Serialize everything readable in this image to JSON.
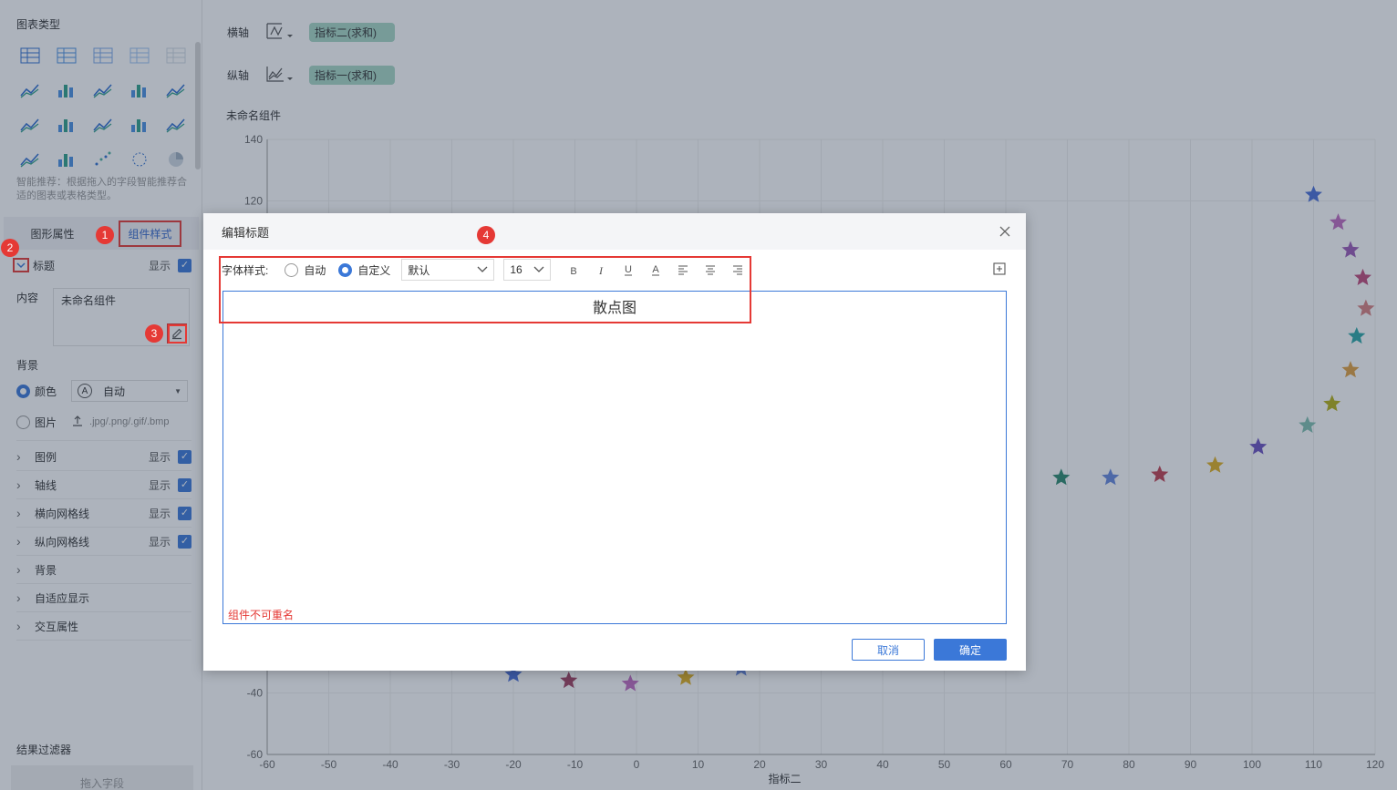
{
  "left_panel": {
    "chart_types_title": "图表类型",
    "chart_types": [
      "table-icon",
      "cross-table-icon",
      "detail-table-icon",
      "kpi-number-icon",
      "text-icon",
      "matrix-icon",
      "heatmap-icon",
      "stacked-bar-icon",
      "bar-icon",
      "grouped-bar-icon",
      "bar-line-icon",
      "step-icon",
      "line-icon",
      "radar-line-icon",
      "radar-icon",
      "area-icon",
      "combo-bar-icon",
      "scatter-icon",
      "bubble-icon",
      "pie-icon"
    ],
    "hint": "智能推荐：根据拖入的字段智能推荐合适的图表或表格类型。",
    "tab_graph": "图形属性",
    "tab_style": "组件样式",
    "title_section": "标题",
    "show": "显示",
    "content_label": "内容",
    "content_value": "未命名组件",
    "background_label": "背景",
    "bg_color": "颜色",
    "bg_auto": "自动",
    "bg_image": "图片",
    "bg_image_formats": ".jpg/.png/.gif/.bmp",
    "sections": [
      "图例",
      "轴线",
      "横向网格线",
      "纵向网格线",
      "背景",
      "自适应显示",
      "交互属性"
    ],
    "filter_title": "结果过滤器",
    "filter_placeholder": "拖入字段"
  },
  "axes": {
    "x_label": "横轴",
    "x_field": "指标二(求和)",
    "y_label": "纵轴",
    "y_field": "指标一(求和)"
  },
  "widget_title": "未命名组件",
  "chart_data": {
    "type": "scatter",
    "xlabel": "指标二",
    "ylabel": "",
    "xlim": [
      -60,
      120
    ],
    "ylim": [
      -60,
      140
    ],
    "x_ticks": [
      -60,
      -50,
      -40,
      -30,
      -20,
      -10,
      0,
      10,
      20,
      30,
      40,
      50,
      60,
      70,
      80,
      90,
      100,
      110,
      120
    ],
    "y_ticks": [
      140,
      120,
      -40,
      -60
    ],
    "marker": "star",
    "points": [
      {
        "x": 110.0,
        "y": 122,
        "color": "#4a6fd8"
      },
      {
        "x": 114.0,
        "y": 113,
        "color": "#c06bc0"
      },
      {
        "x": 116.0,
        "y": 104,
        "color": "#9b59b6"
      },
      {
        "x": 118.0,
        "y": 95,
        "color": "#c0497a"
      },
      {
        "x": 118.5,
        "y": 85,
        "color": "#d98080"
      },
      {
        "x": 117.0,
        "y": 76,
        "color": "#2aa7a7"
      },
      {
        "x": 116.0,
        "y": 65,
        "color": "#e0a040"
      },
      {
        "x": 113.0,
        "y": 54,
        "color": "#b5b015"
      },
      {
        "x": 109.0,
        "y": 47,
        "color": "#80c0b0"
      },
      {
        "x": 101.0,
        "y": 40,
        "color": "#6b52c0"
      },
      {
        "x": 94.0,
        "y": 34,
        "color": "#e0b020"
      },
      {
        "x": 85.0,
        "y": 31,
        "color": "#c04050"
      },
      {
        "x": 77.0,
        "y": 30,
        "color": "#6688dd"
      },
      {
        "x": 69.0,
        "y": 30,
        "color": "#2d8a6e"
      },
      {
        "x": -20.0,
        "y": -34,
        "color": "#4a6fd8"
      },
      {
        "x": -11.0,
        "y": -36,
        "color": "#a04060"
      },
      {
        "x": -1.0,
        "y": -37,
        "color": "#c06bc0"
      },
      {
        "x": 8.0,
        "y": -35,
        "color": "#e0b020"
      },
      {
        "x": 17.0,
        "y": -32,
        "color": "#6688dd"
      }
    ]
  },
  "dialog": {
    "title": "编辑标题",
    "font_style_label": "字体样式:",
    "auto": "自动",
    "custom": "自定义",
    "font_family": "默认",
    "font_size": "16",
    "format_buttons": [
      "bold-icon",
      "italic-icon",
      "underline-icon",
      "font-color-icon",
      "align-left-icon",
      "align-center-icon",
      "align-right-icon"
    ],
    "editor_text": "散点图",
    "error_text": "组件不可重名",
    "cancel": "取消",
    "confirm": "确定"
  },
  "badges": [
    "1",
    "2",
    "3",
    "4"
  ],
  "colors": {
    "accent": "#3b78d8",
    "annotation": "#e53935",
    "pill": "#a8d8c6"
  }
}
